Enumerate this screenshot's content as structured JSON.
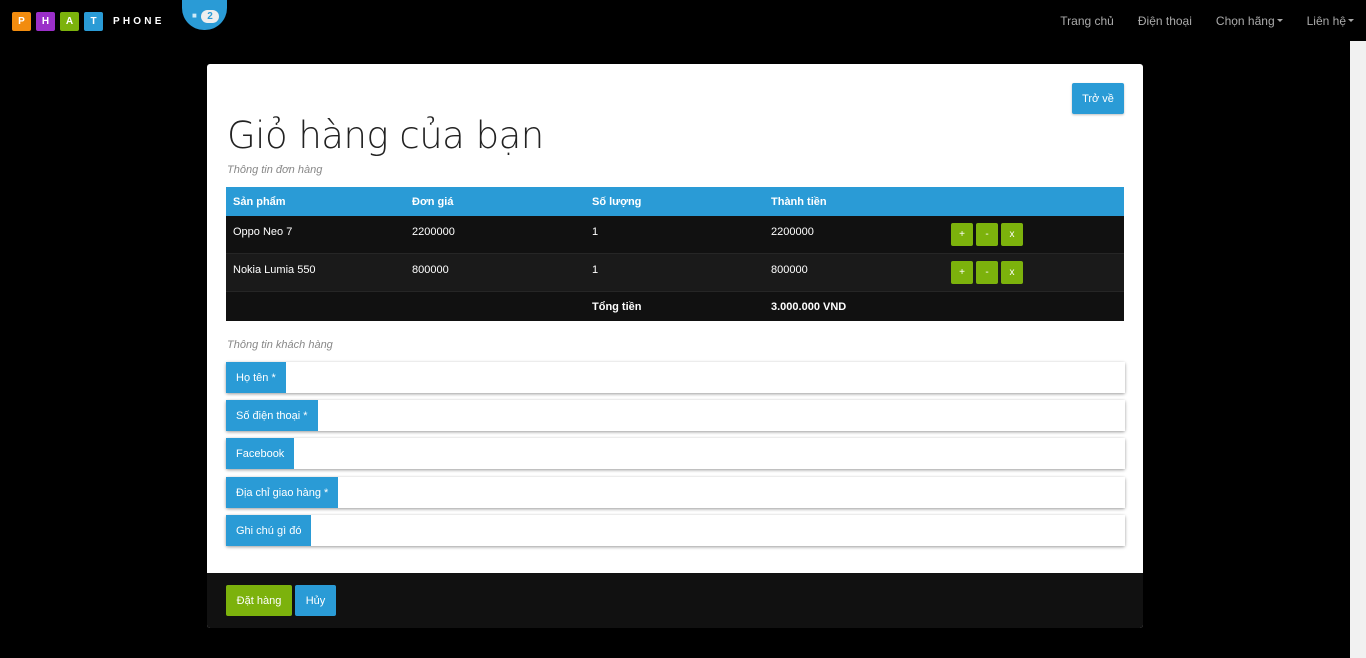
{
  "brand": {
    "letters": [
      "P",
      "H",
      "A",
      "T"
    ],
    "letter_colors": [
      "#f28c0f",
      "#9b2fc9",
      "#7cb20c",
      "#2a9bd6"
    ],
    "word": "PHONE"
  },
  "cart": {
    "icon": "cart-icon",
    "count": "2"
  },
  "nav": {
    "home": "Trang chủ",
    "phones": "Điện thoại",
    "brands": "Chọn hãng",
    "contact": "Liên hệ"
  },
  "page": {
    "back_label": "Trở về",
    "title": "Giỏ hàng của bạn",
    "order_info_label": "Thông tin đơn hàng",
    "customer_info_label": "Thông tin khách hàng"
  },
  "table": {
    "headers": [
      "Sản phẩm",
      "Đơn giá",
      "Số lượng",
      "Thành tiền"
    ],
    "rows": [
      {
        "product": "Oppo Neo 7",
        "price": "2200000",
        "qty": "1",
        "subtotal": "2200000"
      },
      {
        "product": "Nokia Lumia 550",
        "price": "800000",
        "qty": "1",
        "subtotal": "800000"
      }
    ],
    "actions": {
      "increase": "+",
      "decrease": "-",
      "remove": "x"
    },
    "total_label": "Tổng tiền",
    "total_value": "3.000.000 VND"
  },
  "form": {
    "name_label": "Họ tên *",
    "phone_label": "Số điện thoại *",
    "facebook_label": "Facebook",
    "address_label": "Địa chỉ giao hàng *",
    "note_label": "Ghi chú gì đó"
  },
  "footer": {
    "order_label": "Đặt hàng",
    "cancel_label": "Hủy"
  },
  "colors": {
    "accent_blue": "#2a9bd6",
    "accent_green": "#7cb20c",
    "dark": "#111111"
  }
}
